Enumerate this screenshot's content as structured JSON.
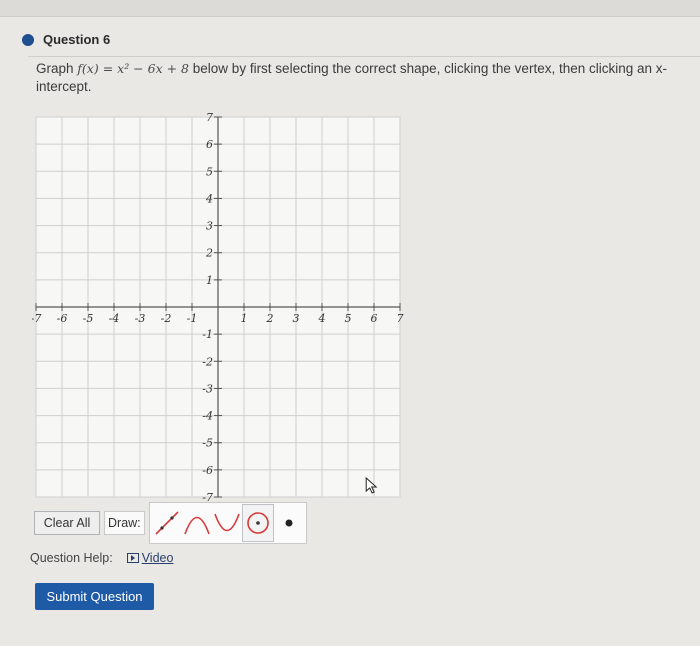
{
  "question": {
    "title": "Question 6",
    "prompt_prefix": "Graph",
    "function_expr": "f(x) = x² − 6x + 8",
    "prompt_suffix": "below by first selecting the correct shape, clicking the vertex, then clicking an x-intercept."
  },
  "graph": {
    "x_range": [
      -7,
      7
    ],
    "y_range": [
      -7,
      7
    ],
    "x_tick_labels": [
      "-7",
      "-6",
      "-5",
      "-4",
      "-3",
      "-2",
      "-1",
      "1",
      "2",
      "3",
      "4",
      "5",
      "6",
      "7"
    ],
    "y_tick_labels": [
      "7",
      "6",
      "5",
      "4",
      "3",
      "2",
      "1",
      "-1",
      "-2",
      "-3",
      "-4",
      "-5",
      "-6",
      "-7"
    ]
  },
  "toolbar": {
    "clear_label": "Clear All",
    "draw_label": "Draw:",
    "tools": [
      "line-tool-icon",
      "parabola-down-icon",
      "parabola-up-icon",
      "circle-icon",
      "point-icon"
    ]
  },
  "help": {
    "label": "Question Help:",
    "video_label": "Video"
  },
  "submit_label": "Submit Question",
  "colors": {
    "accent": "#1f5aa6",
    "line_tool": "#d63a3a",
    "shape_tools": "#d63a3a"
  }
}
